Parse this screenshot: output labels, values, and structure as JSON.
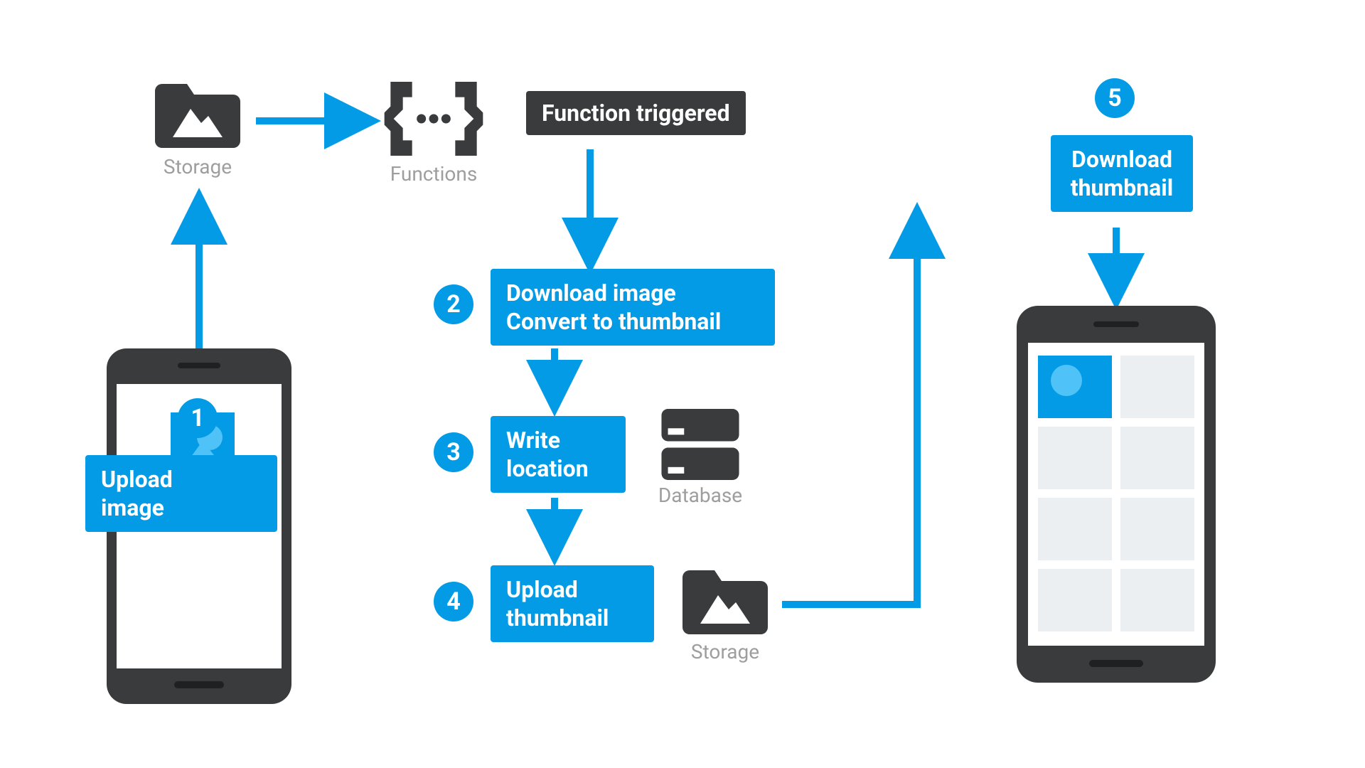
{
  "icons": {
    "storage_top": "Storage",
    "functions": "Functions",
    "database": "Database",
    "storage_bottom": "Storage"
  },
  "steps": {
    "s1": {
      "num": "1",
      "label": "Upload\nimage"
    },
    "s2": {
      "num": "2",
      "label": "Download image\nConvert to thumbnail"
    },
    "s3": {
      "num": "3",
      "label": "Write\nlocation"
    },
    "s4": {
      "num": "4",
      "label": "Upload\nthumbnail"
    },
    "s5": {
      "num": "5",
      "label": "Download\nthumbnail"
    }
  },
  "function_box": "Function triggered",
  "colors": {
    "blue": "#039be5",
    "dark": "#3a3b3c",
    "gray": "#9e9e9e"
  }
}
